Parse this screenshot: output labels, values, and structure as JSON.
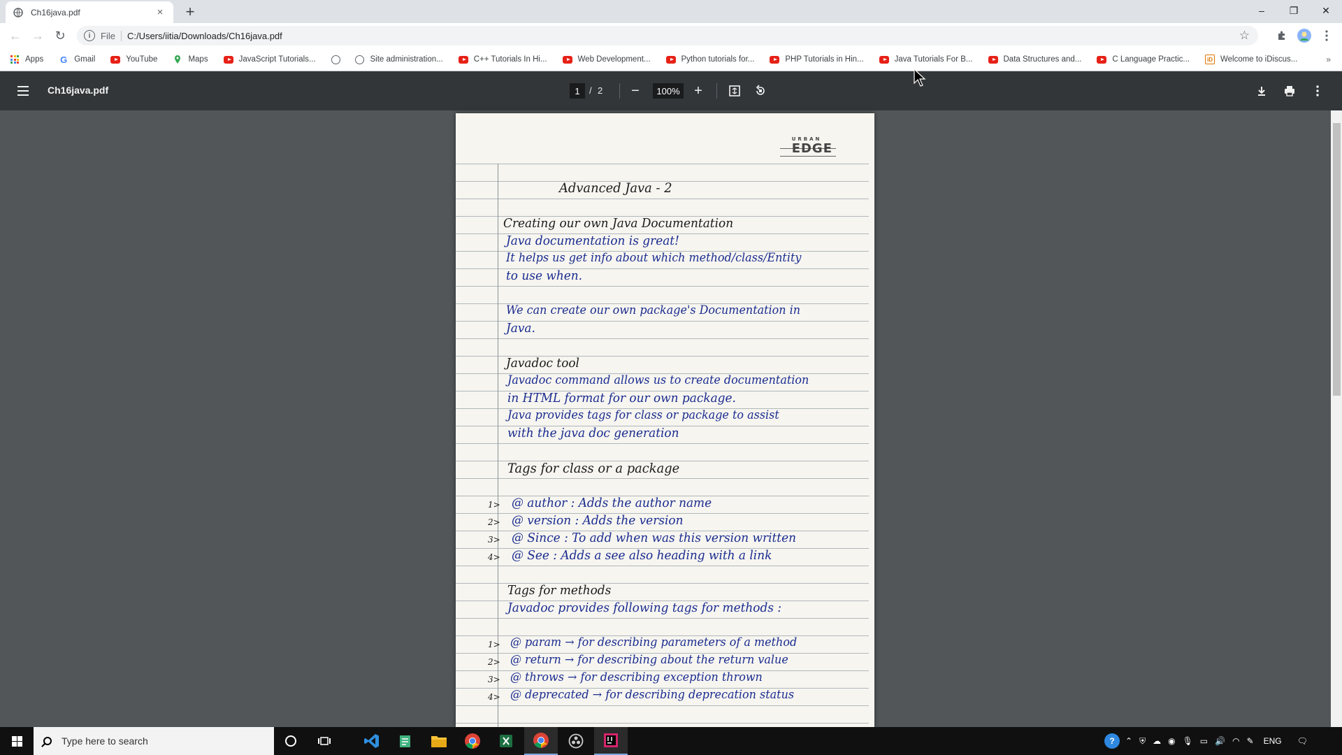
{
  "browser": {
    "tab_title": "Ch16java.pdf",
    "tab_close": "×",
    "new_tab": "+",
    "window": {
      "minimize": "–",
      "restore": "❐",
      "close": "✕"
    },
    "nav": {
      "back": "←",
      "forward": "→",
      "reload": "↻"
    },
    "omnibox": {
      "info": "i",
      "scheme": "File",
      "url": "C:/Users/iitia/Downloads/Ch16java.pdf",
      "star": "☆"
    },
    "bookmarks": [
      {
        "label": "Apps",
        "icon": "apps-grid-icon"
      },
      {
        "label": "Gmail",
        "icon": "google-icon"
      },
      {
        "label": "YouTube",
        "icon": "youtube-icon"
      },
      {
        "label": "Maps",
        "icon": "maps-icon"
      },
      {
        "label": "JavaScript Tutorials...",
        "icon": "youtube-icon"
      },
      {
        "label": "",
        "icon": "globe-icon"
      },
      {
        "label": "Site administration...",
        "icon": "globe-icon"
      },
      {
        "label": "C++ Tutorials In Hi...",
        "icon": "youtube-icon"
      },
      {
        "label": "Web Development...",
        "icon": "youtube-icon"
      },
      {
        "label": "Python tutorials for...",
        "icon": "youtube-icon"
      },
      {
        "label": "PHP Tutorials in Hin...",
        "icon": "youtube-icon"
      },
      {
        "label": "Java Tutorials For B...",
        "icon": "youtube-icon"
      },
      {
        "label": "Data Structures and...",
        "icon": "youtube-icon"
      },
      {
        "label": "C Language Practic...",
        "icon": "youtube-icon"
      },
      {
        "label": "Welcome to iDiscus...",
        "icon": "idiscuss-icon"
      }
    ],
    "bookmarks_more": "»"
  },
  "pdf": {
    "title": "Ch16java.pdf",
    "page_current": "1",
    "page_sep": "/",
    "page_total": "2",
    "zoom": "100%",
    "zoom_out": "−",
    "zoom_in": "+"
  },
  "notebook": {
    "brand_top": "URBAN",
    "brand": "EDGE",
    "lines": [
      {
        "text": "Advanced Java - 2",
        "color": "black",
        "x": 0,
        "top": 0
      },
      {
        "text": "Creating our own Java Documentation",
        "color": "black"
      },
      {
        "text": "Java documentation is great!",
        "color": "blue"
      },
      {
        "text": "It helps us get info about which method/class/Entity",
        "color": "blue"
      },
      {
        "text": "to use when.",
        "color": "blue"
      },
      {
        "text": "We can create our own package's Documentation in",
        "color": "blue"
      },
      {
        "text": "Java.",
        "color": "blue"
      },
      {
        "text": "Javadoc tool",
        "color": "black"
      },
      {
        "text": "Javadoc command allows us to create documentation",
        "color": "blue"
      },
      {
        "text": "in HTML format for our own package.",
        "color": "blue"
      },
      {
        "text": "Java provides tags for class or package to assist",
        "color": "blue"
      },
      {
        "text": "with the java doc generation",
        "color": "blue"
      },
      {
        "text": "Tags for class or a package",
        "color": "black"
      },
      {
        "text": "@ author : Adds the author name",
        "color": "blue"
      },
      {
        "text": "@ version : Adds the version",
        "color": "blue"
      },
      {
        "text": "@ Since : To add when was this version written",
        "color": "blue"
      },
      {
        "text": "@ See : Adds a see also heading with a link",
        "color": "blue"
      },
      {
        "text": "Tags for methods",
        "color": "black"
      },
      {
        "text": "Javadoc provides following tags for methods :",
        "color": "blue"
      },
      {
        "text": "@ param → for describing parameters of a method",
        "color": "blue"
      },
      {
        "text": "@ return → for describing about the return value",
        "color": "blue"
      },
      {
        "text": "@ throws → for describing exception thrown",
        "color": "blue"
      },
      {
        "text": "@ deprecated → for describing deprecation status",
        "color": "blue"
      }
    ],
    "numbers": [
      "1>",
      "2>",
      "3>",
      "4>",
      "1>",
      "2>",
      "3>",
      "4>"
    ]
  },
  "taskbar": {
    "search_placeholder": "Type here to search",
    "language": "ENG"
  }
}
